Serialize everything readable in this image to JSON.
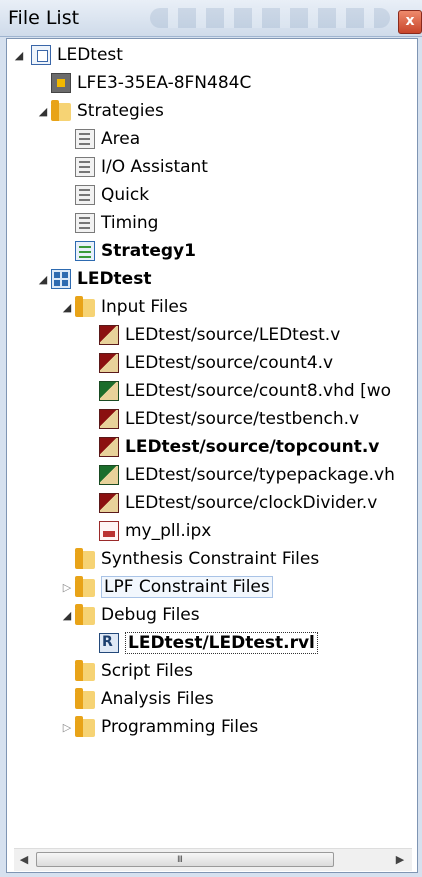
{
  "panel": {
    "title": "File List",
    "close_label": "x"
  },
  "tree": {
    "root": "LEDtest",
    "device": "LFE3-35EA-8FN484C",
    "strategies": {
      "label": "Strategies",
      "items": [
        "Area",
        "I/O Assistant",
        "Quick",
        "Timing",
        "Strategy1"
      ]
    },
    "implementation": "LEDtest",
    "input_files": {
      "label": "Input Files",
      "items": [
        "LEDtest/source/LEDtest.v",
        "LEDtest/source/count4.v",
        "LEDtest/source/count8.vhd [wo",
        "LEDtest/source/testbench.v",
        "LEDtest/source/topcount.v",
        "LEDtest/source/typepackage.vh",
        "LEDtest/source/clockDivider.v",
        "my_pll.ipx"
      ]
    },
    "synthesis_constraint": "Synthesis Constraint Files",
    "lpf_constraint": "LPF Constraint Files",
    "debug_files": {
      "label": "Debug Files",
      "items": [
        "LEDtest/LEDtest.rvl"
      ]
    },
    "script_files": "Script Files",
    "analysis_files": "Analysis Files",
    "programming_files": "Programming Files"
  },
  "scrollbar": {
    "left_arrow": "◀",
    "right_arrow": "▶",
    "grip": "III"
  }
}
